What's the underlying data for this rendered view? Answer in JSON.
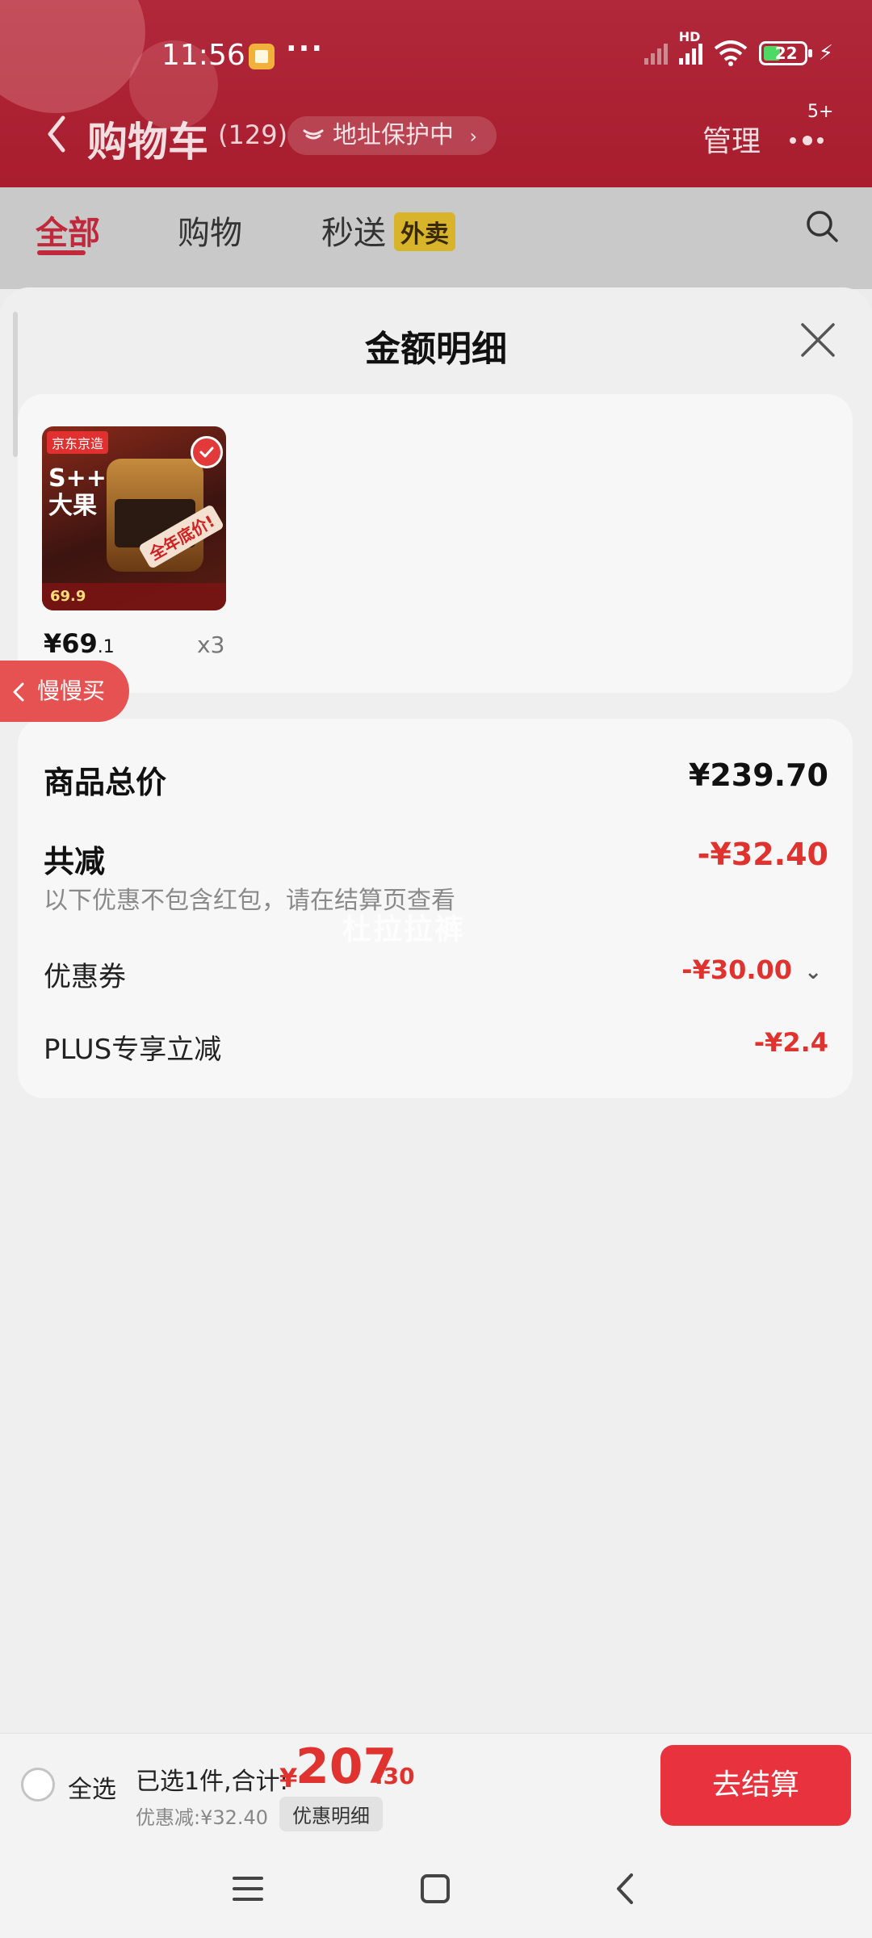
{
  "status": {
    "time": "11:56",
    "more": "···",
    "network": "HD",
    "battery": "22"
  },
  "nav": {
    "title": "购物车",
    "count": "(129)",
    "address_protect": "地址保护中",
    "manage": "管理",
    "more_badge": "5+"
  },
  "tabs": [
    {
      "label": "全部"
    },
    {
      "label": "购物"
    },
    {
      "label": "秒送"
    }
  ],
  "tab_tag": "外卖",
  "sheet": {
    "title": "金额明细",
    "product": {
      "image_logo": "京东京造",
      "image_headline": "S++\n大果",
      "image_ribbon": "全年底价!",
      "image_price": "69.9",
      "price_int": "¥69",
      "price_dec": ".1",
      "qty": "x3"
    },
    "slow_buy": "慢慢买",
    "summary": {
      "total_label": "商品总价",
      "total_value": "¥239.70",
      "reduce_label": "共减",
      "reduce_value": "-¥32.40",
      "note": "以下优惠不包含红包，请在结算页查看",
      "coupon_label": "优惠券",
      "coupon_value": "-¥30.00",
      "plus_label": "PLUS专享立减",
      "plus_value": "-¥2.4"
    },
    "watermark": "杜拉拉裤"
  },
  "bottom": {
    "select_all": "全选",
    "selected": "已选1件,合计:",
    "yen": "¥",
    "total_int": "207",
    "total_dec": ".30",
    "discount": "优惠减:¥32.40",
    "detail": "优惠明细",
    "checkout": "去结算"
  },
  "colors": {
    "brand_red": "#e0332f",
    "header_red": "#a91d2e",
    "tag_yellow": "#d8b42a"
  }
}
